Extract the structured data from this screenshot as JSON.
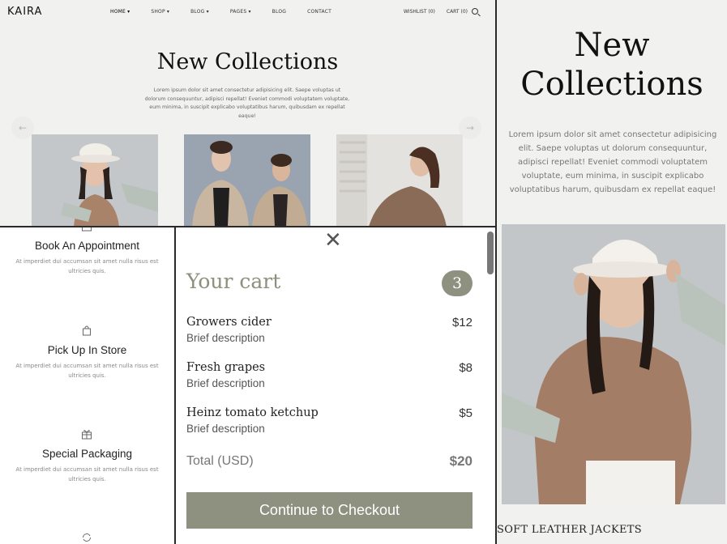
{
  "header": {
    "brand": "KAIRA",
    "menu": [
      "HOME ▾",
      "SHOP ▾",
      "BLOG ▾",
      "PAGES ▾",
      "BLOG",
      "CONTACT"
    ],
    "wishlist": "WISHLIST (0)",
    "cart": "CART (0)"
  },
  "hero": {
    "title": "New Collections",
    "text": "Lorem ipsum dolor sit amet consectetur adipisicing elit. Saepe voluptas ut dolorum consequuntur, adipisci repellat! Eveniet commodi voluptatem voluptate, eum minima, in suscipit explicabo voluptatibus harum, quibusdam ex repellat eaque!",
    "prev": "←",
    "next": "→"
  },
  "services": [
    {
      "title": "Book An Appointment",
      "desc": "At imperdiet dui accumsan sit amet nulla risus est ultricies quis."
    },
    {
      "title": "Pick Up In Store",
      "desc": "At imperdiet dui accumsan sit amet nulla risus est ultricies quis."
    },
    {
      "title": "Special Packaging",
      "desc": "At imperdiet dui accumsan sit amet nulla risus est ultricies quis."
    }
  ],
  "cart": {
    "close": "✕",
    "title": "Your cart",
    "count": "3",
    "items": [
      {
        "name": "Growers cider",
        "desc": "Brief description",
        "price": "$12"
      },
      {
        "name": "Fresh grapes",
        "desc": "Brief description",
        "price": "$8"
      },
      {
        "name": "Heinz tomato ketchup",
        "desc": "Brief description",
        "price": "$5"
      }
    ],
    "total_label": "Total (USD)",
    "total_value": "$20",
    "checkout": "Continue to Checkout"
  },
  "mobile": {
    "title": "New Collections",
    "text": "Lorem ipsum dolor sit amet consectetur adipisicing elit. Saepe voluptas ut dolorum consequuntur, adipisci repellat! Eveniet commodi voluptatem voluptate, eum minima, in suscipit explicabo voluptatibus harum, quibusdam ex repellat eaque!",
    "caption": "SOFT LEATHER JACKETS"
  },
  "colors": {
    "accent": "#8e9180",
    "accent_text": "#8e8f7c",
    "page_bg": "#f1f1f0"
  }
}
